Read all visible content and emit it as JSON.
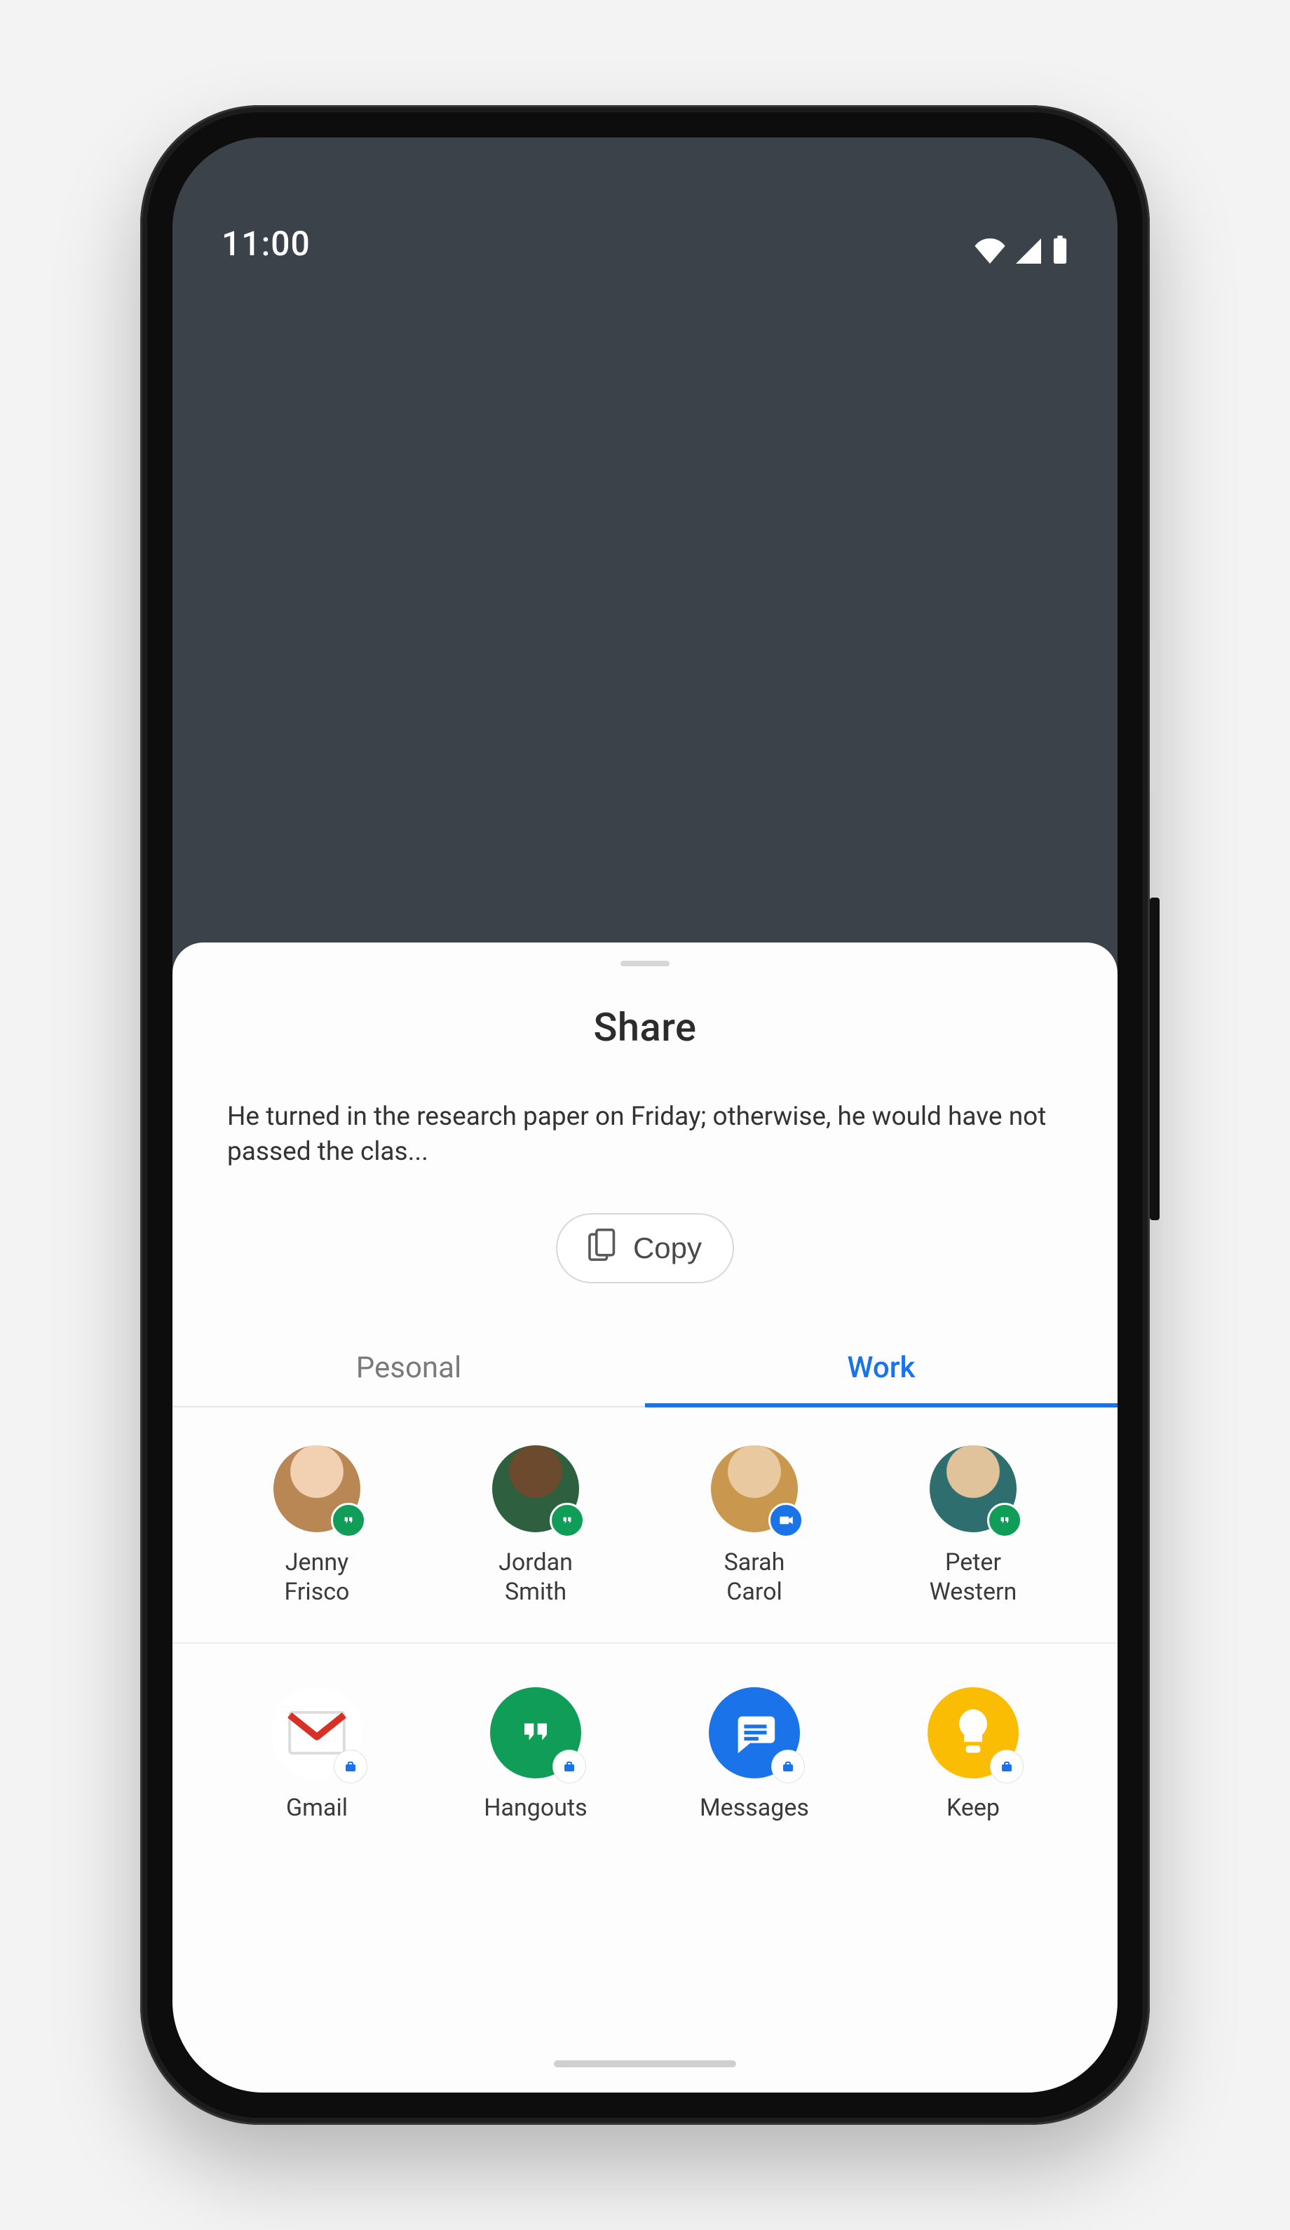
{
  "statusbar": {
    "time": "11:00"
  },
  "sheet": {
    "title": "Share",
    "text": "He turned in the research paper on Friday; otherwise, he would have not passed the clas...",
    "copy_label": "Copy"
  },
  "tabs": [
    {
      "label": "Pesonal",
      "active": false
    },
    {
      "label": "Work",
      "active": true
    }
  ],
  "contacts": [
    {
      "first": "Jenny",
      "last": "Frisco",
      "badge": "hangouts"
    },
    {
      "first": "Jordan",
      "last": "Smith",
      "badge": "hangouts"
    },
    {
      "first": "Sarah",
      "last": "Carol",
      "badge": "meet"
    },
    {
      "first": "Peter",
      "last": "Western",
      "badge": "hangouts"
    }
  ],
  "apps": [
    {
      "name": "Gmail",
      "icon": "gmail"
    },
    {
      "name": "Hangouts",
      "icon": "hangouts"
    },
    {
      "name": "Messages",
      "icon": "messages"
    },
    {
      "name": "Keep",
      "icon": "keep"
    }
  ]
}
